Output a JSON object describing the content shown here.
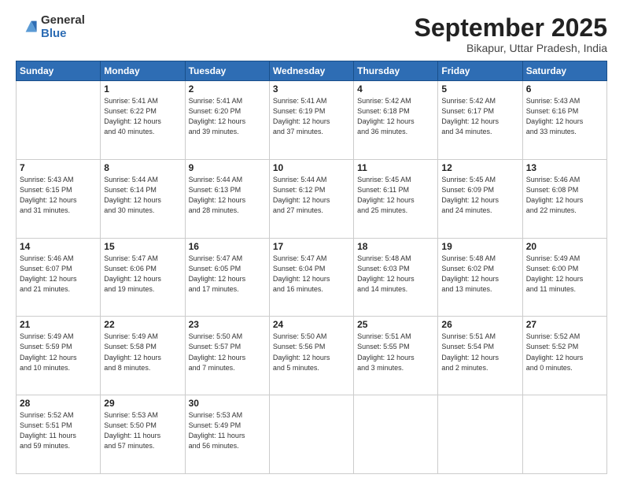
{
  "logo": {
    "general": "General",
    "blue": "Blue"
  },
  "header": {
    "title": "September 2025",
    "subtitle": "Bikapur, Uttar Pradesh, India"
  },
  "weekdays": [
    "Sunday",
    "Monday",
    "Tuesday",
    "Wednesday",
    "Thursday",
    "Friday",
    "Saturday"
  ],
  "weeks": [
    [
      {
        "day": "",
        "info": ""
      },
      {
        "day": "1",
        "info": "Sunrise: 5:41 AM\nSunset: 6:22 PM\nDaylight: 12 hours\nand 40 minutes."
      },
      {
        "day": "2",
        "info": "Sunrise: 5:41 AM\nSunset: 6:20 PM\nDaylight: 12 hours\nand 39 minutes."
      },
      {
        "day": "3",
        "info": "Sunrise: 5:41 AM\nSunset: 6:19 PM\nDaylight: 12 hours\nand 37 minutes."
      },
      {
        "day": "4",
        "info": "Sunrise: 5:42 AM\nSunset: 6:18 PM\nDaylight: 12 hours\nand 36 minutes."
      },
      {
        "day": "5",
        "info": "Sunrise: 5:42 AM\nSunset: 6:17 PM\nDaylight: 12 hours\nand 34 minutes."
      },
      {
        "day": "6",
        "info": "Sunrise: 5:43 AM\nSunset: 6:16 PM\nDaylight: 12 hours\nand 33 minutes."
      }
    ],
    [
      {
        "day": "7",
        "info": "Sunrise: 5:43 AM\nSunset: 6:15 PM\nDaylight: 12 hours\nand 31 minutes."
      },
      {
        "day": "8",
        "info": "Sunrise: 5:44 AM\nSunset: 6:14 PM\nDaylight: 12 hours\nand 30 minutes."
      },
      {
        "day": "9",
        "info": "Sunrise: 5:44 AM\nSunset: 6:13 PM\nDaylight: 12 hours\nand 28 minutes."
      },
      {
        "day": "10",
        "info": "Sunrise: 5:44 AM\nSunset: 6:12 PM\nDaylight: 12 hours\nand 27 minutes."
      },
      {
        "day": "11",
        "info": "Sunrise: 5:45 AM\nSunset: 6:11 PM\nDaylight: 12 hours\nand 25 minutes."
      },
      {
        "day": "12",
        "info": "Sunrise: 5:45 AM\nSunset: 6:09 PM\nDaylight: 12 hours\nand 24 minutes."
      },
      {
        "day": "13",
        "info": "Sunrise: 5:46 AM\nSunset: 6:08 PM\nDaylight: 12 hours\nand 22 minutes."
      }
    ],
    [
      {
        "day": "14",
        "info": "Sunrise: 5:46 AM\nSunset: 6:07 PM\nDaylight: 12 hours\nand 21 minutes."
      },
      {
        "day": "15",
        "info": "Sunrise: 5:47 AM\nSunset: 6:06 PM\nDaylight: 12 hours\nand 19 minutes."
      },
      {
        "day": "16",
        "info": "Sunrise: 5:47 AM\nSunset: 6:05 PM\nDaylight: 12 hours\nand 17 minutes."
      },
      {
        "day": "17",
        "info": "Sunrise: 5:47 AM\nSunset: 6:04 PM\nDaylight: 12 hours\nand 16 minutes."
      },
      {
        "day": "18",
        "info": "Sunrise: 5:48 AM\nSunset: 6:03 PM\nDaylight: 12 hours\nand 14 minutes."
      },
      {
        "day": "19",
        "info": "Sunrise: 5:48 AM\nSunset: 6:02 PM\nDaylight: 12 hours\nand 13 minutes."
      },
      {
        "day": "20",
        "info": "Sunrise: 5:49 AM\nSunset: 6:00 PM\nDaylight: 12 hours\nand 11 minutes."
      }
    ],
    [
      {
        "day": "21",
        "info": "Sunrise: 5:49 AM\nSunset: 5:59 PM\nDaylight: 12 hours\nand 10 minutes."
      },
      {
        "day": "22",
        "info": "Sunrise: 5:49 AM\nSunset: 5:58 PM\nDaylight: 12 hours\nand 8 minutes."
      },
      {
        "day": "23",
        "info": "Sunrise: 5:50 AM\nSunset: 5:57 PM\nDaylight: 12 hours\nand 7 minutes."
      },
      {
        "day": "24",
        "info": "Sunrise: 5:50 AM\nSunset: 5:56 PM\nDaylight: 12 hours\nand 5 minutes."
      },
      {
        "day": "25",
        "info": "Sunrise: 5:51 AM\nSunset: 5:55 PM\nDaylight: 12 hours\nand 3 minutes."
      },
      {
        "day": "26",
        "info": "Sunrise: 5:51 AM\nSunset: 5:54 PM\nDaylight: 12 hours\nand 2 minutes."
      },
      {
        "day": "27",
        "info": "Sunrise: 5:52 AM\nSunset: 5:52 PM\nDaylight: 12 hours\nand 0 minutes."
      }
    ],
    [
      {
        "day": "28",
        "info": "Sunrise: 5:52 AM\nSunset: 5:51 PM\nDaylight: 11 hours\nand 59 minutes."
      },
      {
        "day": "29",
        "info": "Sunrise: 5:53 AM\nSunset: 5:50 PM\nDaylight: 11 hours\nand 57 minutes."
      },
      {
        "day": "30",
        "info": "Sunrise: 5:53 AM\nSunset: 5:49 PM\nDaylight: 11 hours\nand 56 minutes."
      },
      {
        "day": "",
        "info": ""
      },
      {
        "day": "",
        "info": ""
      },
      {
        "day": "",
        "info": ""
      },
      {
        "day": "",
        "info": ""
      }
    ]
  ]
}
